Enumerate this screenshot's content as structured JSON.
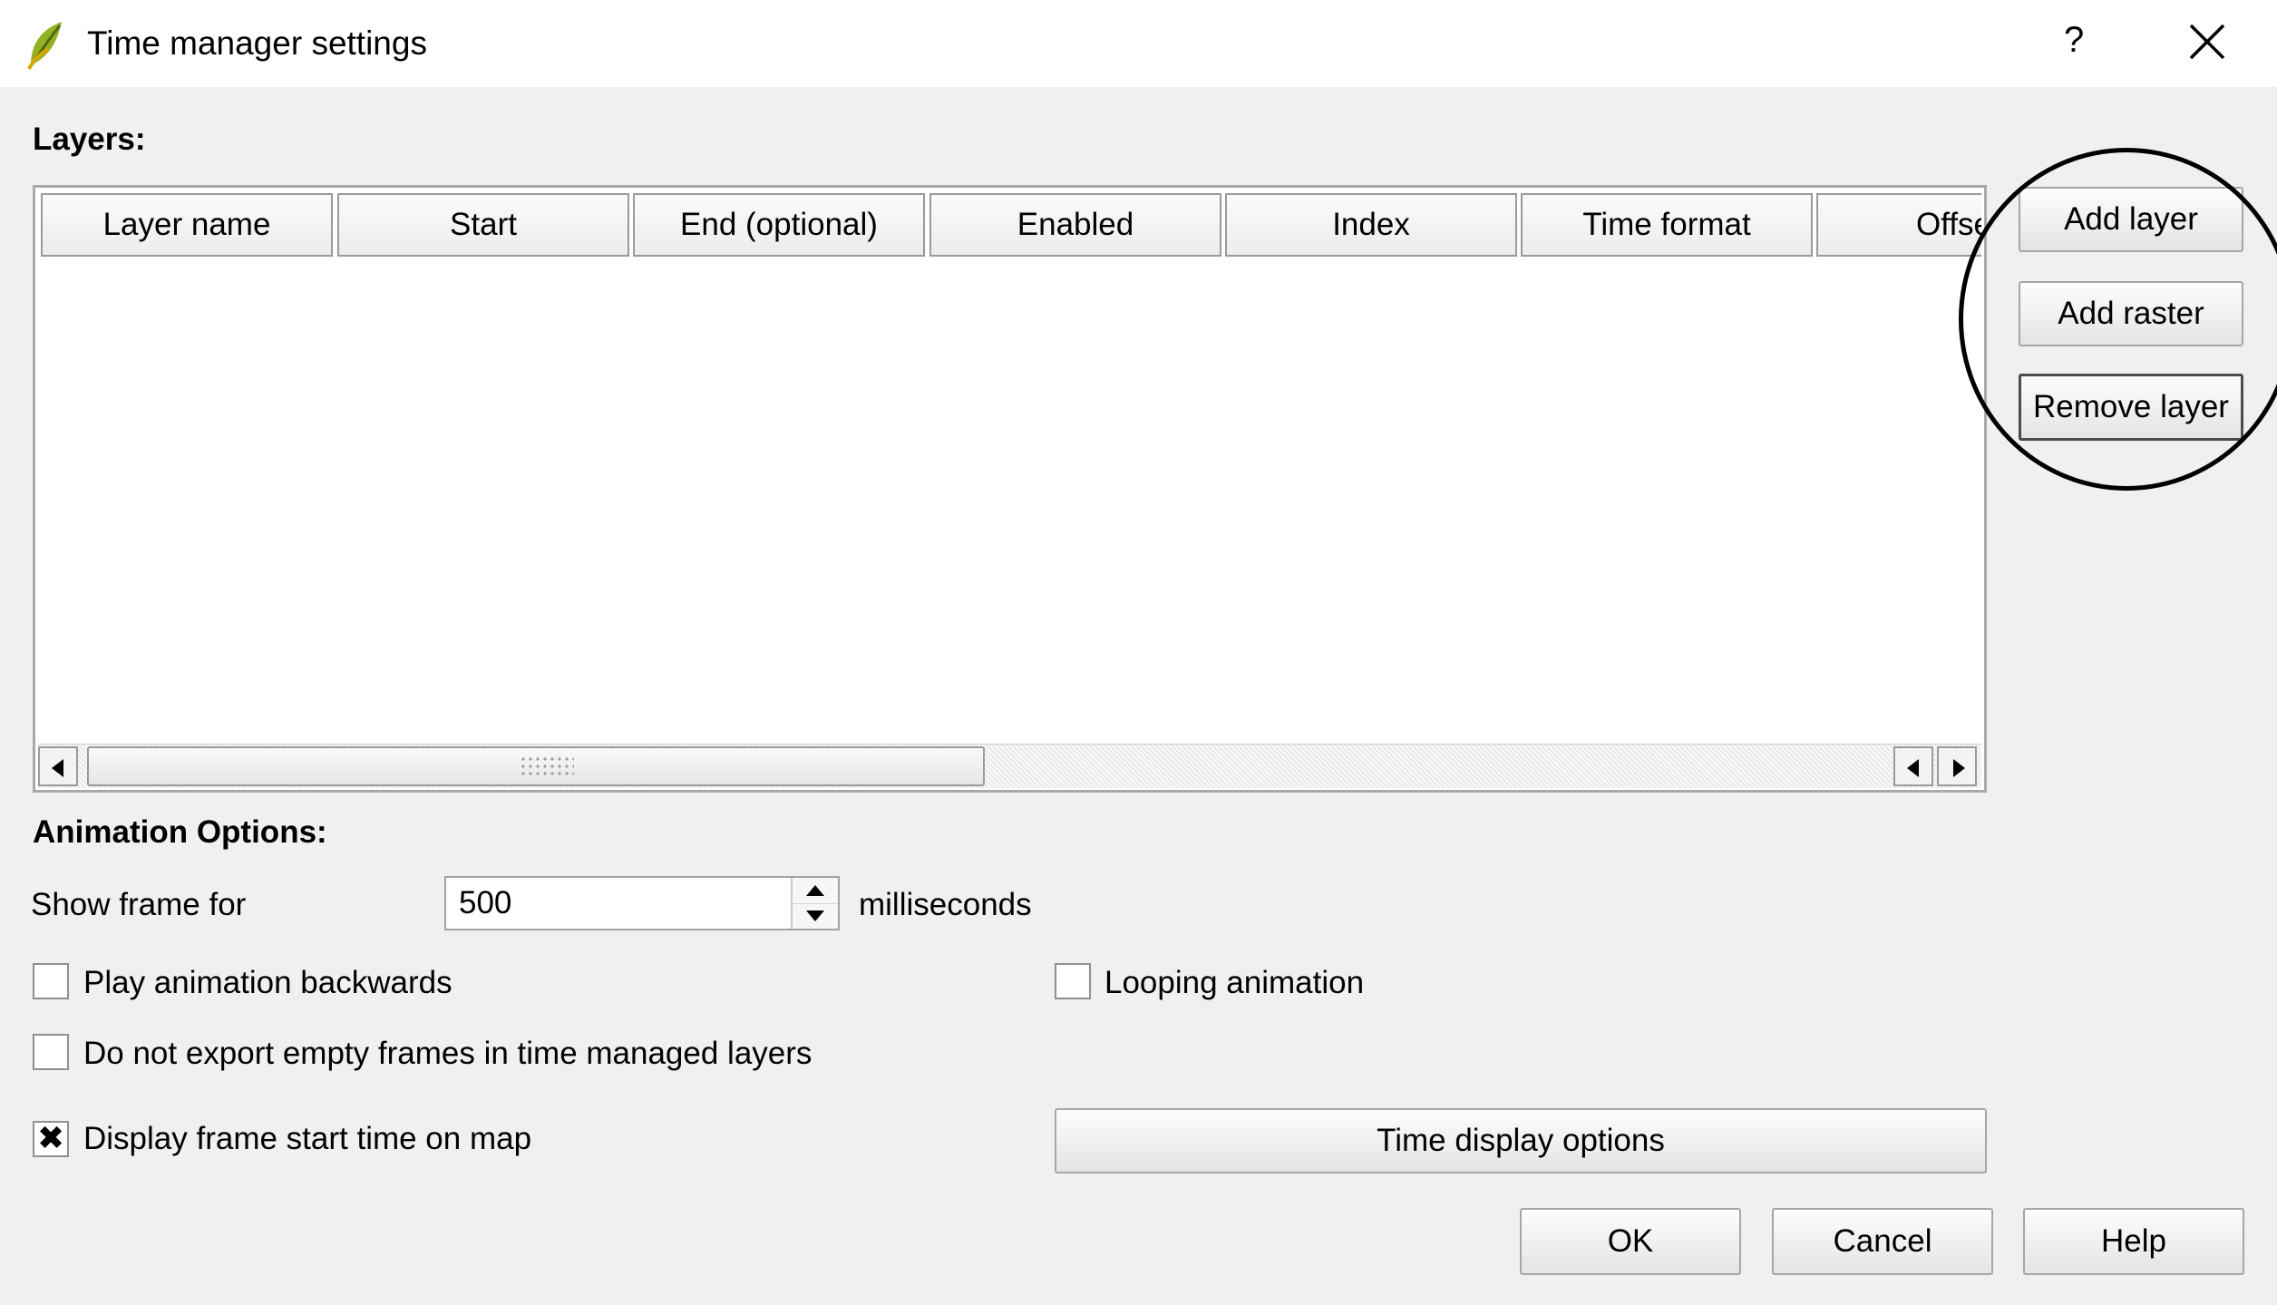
{
  "window": {
    "title": "Time manager settings",
    "help_glyph": "?",
    "close_icon": "close-icon",
    "app_icon": "qgis-leaf-icon"
  },
  "layers": {
    "section_label": "Layers:",
    "columns": [
      "Layer name",
      "Start",
      "End (optional)",
      "Enabled",
      "Index",
      "Time format",
      "Offset"
    ],
    "rows": [],
    "scroll_position": 0.0
  },
  "side_buttons": {
    "add_layer": "Add layer",
    "add_raster": "Add raster",
    "remove_layer": "Remove layer"
  },
  "animation": {
    "section_label": "Animation Options:",
    "show_frame_label": "Show frame for",
    "frame_duration_value": "500",
    "frame_duration_unit": "milliseconds",
    "play_backwards_label": "Play animation backwards",
    "play_backwards_checked": false,
    "looping_label": "Looping animation",
    "looping_checked": false,
    "no_export_empty_label": "Do not export empty frames in time managed layers",
    "no_export_empty_checked": false,
    "display_start_time_label": "Display frame start time on map",
    "display_start_time_checked": true,
    "check_glyph": "✖",
    "time_display_options_label": "Time display options"
  },
  "footer": {
    "ok_label": "OK",
    "cancel_label": "Cancel",
    "help_label": "Help"
  }
}
